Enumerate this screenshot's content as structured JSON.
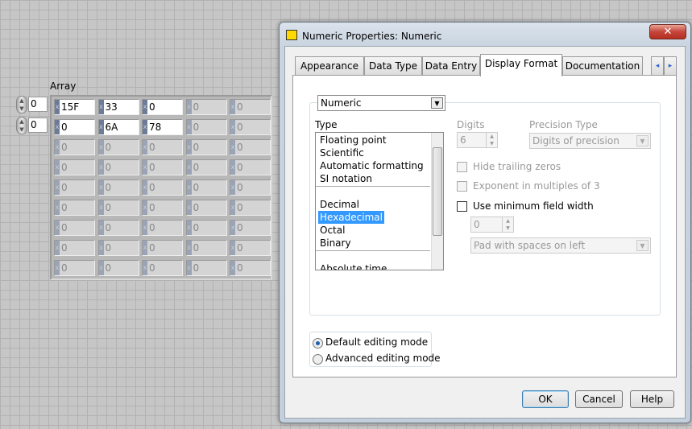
{
  "array": {
    "label": "Array",
    "indices": [
      "0",
      "0"
    ],
    "cells": [
      [
        "15F",
        "33",
        "0",
        "0",
        "0"
      ],
      [
        "0",
        "6A",
        "78",
        "0",
        "0"
      ],
      [
        "0",
        "0",
        "0",
        "0",
        "0"
      ],
      [
        "0",
        "0",
        "0",
        "0",
        "0"
      ],
      [
        "0",
        "0",
        "0",
        "0",
        "0"
      ],
      [
        "0",
        "0",
        "0",
        "0",
        "0"
      ],
      [
        "0",
        "0",
        "0",
        "0",
        "0"
      ],
      [
        "0",
        "0",
        "0",
        "0",
        "0"
      ],
      [
        "0",
        "0",
        "0",
        "0",
        "0"
      ]
    ],
    "active_cells": [
      [
        0,
        0
      ],
      [
        0,
        1
      ],
      [
        0,
        2
      ],
      [
        1,
        0
      ],
      [
        1,
        1
      ],
      [
        1,
        2
      ]
    ],
    "radix_glyph": "x"
  },
  "dialog": {
    "title": "Numeric Properties: Numeric",
    "close": "✕",
    "tabs": [
      "Appearance",
      "Data Type",
      "Data Entry",
      "Display Format",
      "Documentation"
    ],
    "active_tab": "Display Format",
    "tab_scroll": [
      "◂",
      "▸"
    ],
    "format_select": "Numeric",
    "type_label": "Type",
    "type_items": [
      "Floating point",
      "Scientific",
      "Automatic formatting",
      "SI notation",
      "Decimal",
      "Hexadecimal",
      "Octal",
      "Binary",
      "Absolute time"
    ],
    "selected_type": "Hexadecimal",
    "digits_label": "Digits",
    "digits_value": "6",
    "precision_type_label": "Precision Type",
    "precision_type_value": "Digits of precision",
    "hide_trailing_zeros": "Hide trailing zeros",
    "exponent_multiples": "Exponent in multiples of 3",
    "use_min_width": "Use minimum field width",
    "min_width_value": "0",
    "pad_value": "Pad with spaces on left",
    "default_mode": "Default editing mode",
    "advanced_mode": "Advanced editing mode",
    "ok": "OK",
    "cancel": "Cancel",
    "help": "Help"
  }
}
